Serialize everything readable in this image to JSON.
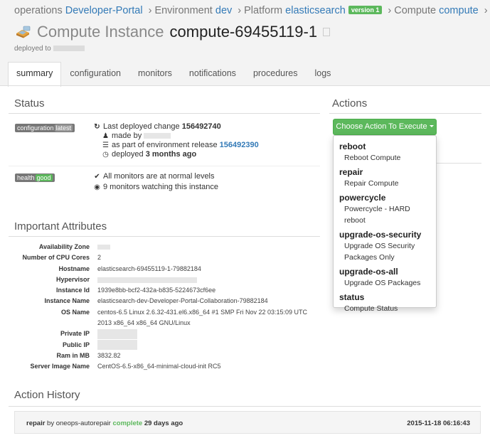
{
  "breadcrumb": {
    "org_label": "operations",
    "org_link": "Developer-Portal",
    "env_label": "Environment",
    "env_link": "dev",
    "platform_label": "Platform",
    "platform_link": "elasticsearch",
    "version_badge": "version 1",
    "compute_label": "Compute",
    "compute_link": "compute",
    "separator": "›"
  },
  "page": {
    "kind": "Compute Instance",
    "name": "compute-69455119-1",
    "deployed_to_label": "deployed to"
  },
  "tabs": [
    {
      "label": "summary",
      "active": true
    },
    {
      "label": "configuration",
      "active": false
    },
    {
      "label": "monitors",
      "active": false
    },
    {
      "label": "notifications",
      "active": false
    },
    {
      "label": "procedures",
      "active": false
    },
    {
      "label": "logs",
      "active": false
    }
  ],
  "status": {
    "title": "Status",
    "configuration": {
      "label": "configuration",
      "value": "latest",
      "last_change_label": "Last deployed change",
      "last_change_id": "156492740",
      "made_by_label": "made by",
      "release_label": "as part of environment release",
      "release_id": "156492390",
      "deployed_label": "deployed",
      "deployed_ago": "3 months ago"
    },
    "health": {
      "label": "health",
      "value": "good",
      "monitors_text": "All monitors are at normal levels",
      "watching_text": "9 monitors watching this instance"
    }
  },
  "attributes": {
    "title": "Important Attributes",
    "rows": [
      {
        "key": "Availability Zone",
        "value": ""
      },
      {
        "key": "Number of CPU Cores",
        "value": "2"
      },
      {
        "key": "Hostname",
        "value": "elasticsearch-69455119-1-79882184"
      },
      {
        "key": "Hypervisor",
        "value": ""
      },
      {
        "key": "Instance Id",
        "value": "1939e8bb-bcf2-432a-b835-5224673cf6ee"
      },
      {
        "key": "Instance Name",
        "value": "elasticsearch-dev-Developer-Portal-Collaboration-79882184"
      },
      {
        "key": "OS Name",
        "value": "centos-6.5 Linux 2.6.32-431.el6.x86_64 #1 SMP Fri Nov 22 03:15:09 UTC"
      },
      {
        "key": "",
        "value": "2013 x86_64 x86_64 GNU/Linux"
      },
      {
        "key": "Private IP",
        "value": ""
      },
      {
        "key": "Public IP",
        "value": ""
      },
      {
        "key": "Ram in MB",
        "value": "3832.82"
      },
      {
        "key": "Server Image Name",
        "value": "CentOS-6.5-x86_64-minimal-cloud-init RC5"
      }
    ]
  },
  "history": {
    "title": "Action History",
    "action": "repair",
    "by_label": "by",
    "user": "oneops-autorepair",
    "state": "complete",
    "ago": "29 days ago",
    "timestamp": "2015-11-18 06:16:43"
  },
  "actions": {
    "title": "Actions",
    "button_label": "Choose Action To Execute",
    "menu": [
      {
        "name": "reboot",
        "desc": [
          "Reboot Compute"
        ]
      },
      {
        "name": "repair",
        "desc": [
          "Repair Compute"
        ]
      },
      {
        "name": "powercycle",
        "desc": [
          "Powercycle - HARD",
          "reboot"
        ]
      },
      {
        "name": "upgrade-os-security",
        "desc": [
          "Upgrade OS Security",
          "Packages Only"
        ]
      },
      {
        "name": "upgrade-os-all",
        "desc": [
          "Upgrade OS Packages"
        ]
      },
      {
        "name": "status",
        "desc": [
          "Compute Status"
        ]
      }
    ]
  },
  "colors": {
    "accent_green": "#5cb85c",
    "link_blue": "#337ab7",
    "header_bg": "#f3f3f3"
  }
}
